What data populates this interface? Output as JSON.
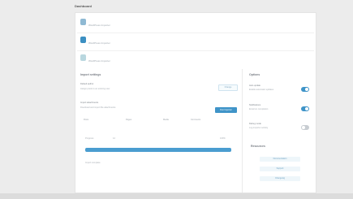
{
  "header": {
    "title": "Dashboard"
  },
  "list": [
    {
      "label": "WordPress Importer",
      "icon": "plugin-icon"
    },
    {
      "label": "WordPress Importer",
      "icon": "plugin-icon"
    },
    {
      "label": "WordPress Importer",
      "icon": "plugin-icon"
    }
  ],
  "main": {
    "title": "Import settings",
    "setting_a": {
      "label": "Default author",
      "desc": "Assign posts to an existing user",
      "button": "Change"
    },
    "setting_b": {
      "label": "Import attachments",
      "desc": "Download and import file attachments",
      "button": "Run Importer"
    },
    "options": [
      "Posts",
      "Pages",
      "Media",
      "Comments"
    ],
    "progress": {
      "label": "Progress",
      "count": "12",
      "value_text": "100%",
      "value": 1.0
    },
    "note": "Import complete"
  },
  "side": {
    "title": "Options",
    "toggles": [
      {
        "label": "Auto update",
        "desc": "Enable automatic updates",
        "on": true
      },
      {
        "label": "Notifications",
        "desc": "Email on completion",
        "on": true
      },
      {
        "label": "Debug mode",
        "desc": "Log importer activity",
        "on": false
      }
    ],
    "links_title": "Resources",
    "links": [
      "Documentation",
      "Support",
      "Changelog"
    ]
  }
}
